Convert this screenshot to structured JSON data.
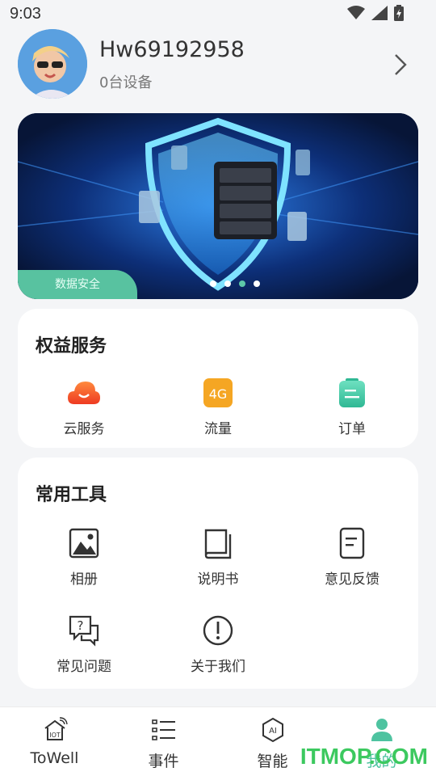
{
  "status_bar": {
    "time": "9:03"
  },
  "profile": {
    "username": "Hw69192958",
    "device_count": "0台设备"
  },
  "banner": {
    "tag": "数据安全",
    "dots": 4,
    "active_dot": 3
  },
  "benefits": {
    "title": "权益服务",
    "items": [
      {
        "label": "云服务",
        "icon": "cloud-icon",
        "color": "#f0552a"
      },
      {
        "label": "流量",
        "icon": "4g-icon",
        "color": "#f5a623"
      },
      {
        "label": "订单",
        "icon": "order-icon",
        "color": "#3ec5a0"
      }
    ]
  },
  "tools": {
    "title": "常用工具",
    "items": [
      {
        "label": "相册",
        "icon": "album-icon"
      },
      {
        "label": "说明书",
        "icon": "manual-icon"
      },
      {
        "label": "意见反馈",
        "icon": "feedback-icon"
      },
      {
        "label": "常见问题",
        "icon": "faq-icon"
      },
      {
        "label": "关于我们",
        "icon": "about-icon"
      }
    ]
  },
  "tabbar": {
    "tabs": [
      {
        "label": "ToWell",
        "icon": "home-iot-icon"
      },
      {
        "label": "事件",
        "icon": "list-icon"
      },
      {
        "label": "智能",
        "icon": "ai-icon"
      },
      {
        "label": "我的",
        "icon": "person-icon",
        "active": true
      }
    ]
  },
  "watermark": "ITMOP.COM",
  "colors": {
    "accent": "#4ec3a0",
    "background": "#f4f5f7"
  }
}
